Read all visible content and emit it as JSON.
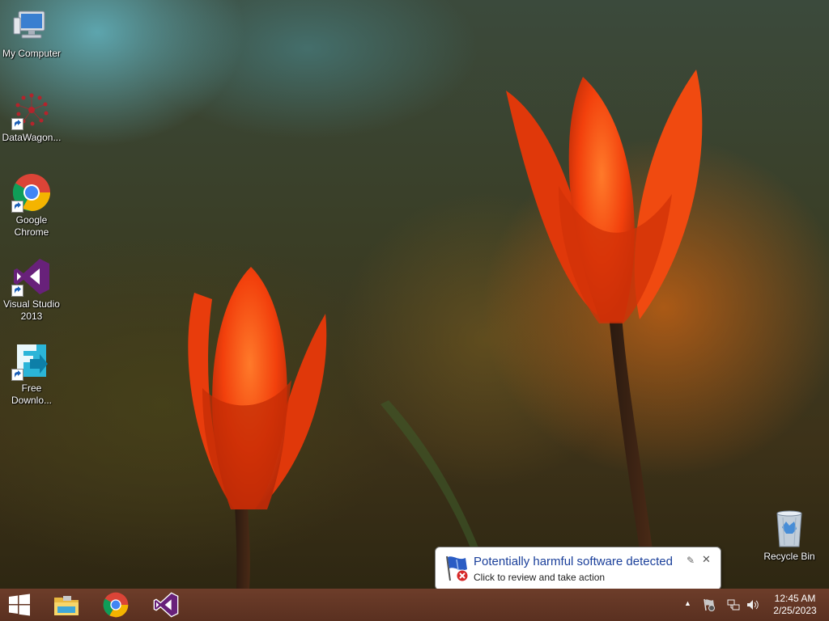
{
  "desktop": {
    "icons": [
      {
        "label": "My Computer",
        "icon": "computer-icon"
      },
      {
        "label": "DataWagon...",
        "icon": "datawagon-icon"
      },
      {
        "label": "Google Chrome",
        "icon": "chrome-icon"
      },
      {
        "label": "Visual Studio 2013",
        "icon": "visual-studio-icon"
      },
      {
        "label": "Free Downlo...",
        "icon": "free-download-manager-icon"
      },
      {
        "label": "Recycle Bin",
        "icon": "recycle-bin-icon"
      }
    ]
  },
  "notification": {
    "title": "Potentially harmful software detected",
    "text": "Click to review and take action",
    "icon": "windows-defender-warning-icon",
    "options_glyph": "✎",
    "close_glyph": "✕"
  },
  "taskbar": {
    "start": "windows-start-icon",
    "pinned": [
      {
        "name": "file-explorer",
        "icon": "file-explorer-icon"
      },
      {
        "name": "google-chrome",
        "icon": "chrome-icon"
      },
      {
        "name": "visual-studio",
        "icon": "visual-studio-icon"
      }
    ],
    "tray": {
      "show_hidden_glyph": "▲",
      "time": "12:45 AM",
      "date": "2/25/2023"
    }
  },
  "colors": {
    "taskbar": "#5f3423",
    "balloon_title": "#1a3f9a",
    "tulip": "#ff4a10"
  }
}
